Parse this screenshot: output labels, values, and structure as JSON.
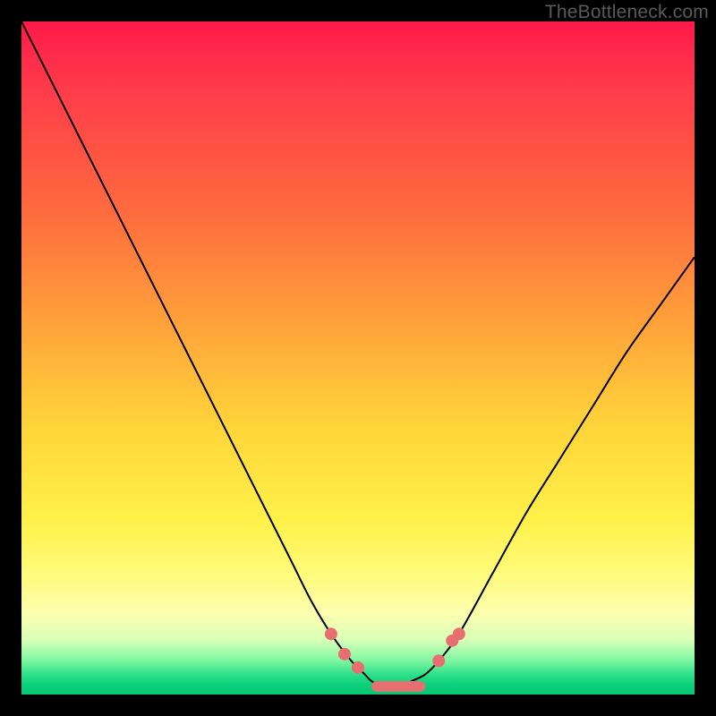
{
  "watermark": "TheBottleneck.com",
  "colors": {
    "frame": "#000000",
    "curve": "#000000",
    "marker": "#e76f6f",
    "gradient_top": "#ff1a48",
    "gradient_bottom": "#08c774"
  },
  "chart_data": {
    "type": "line",
    "title": "",
    "xlabel": "",
    "ylabel": "",
    "xlim": [
      0,
      100
    ],
    "ylim": [
      0,
      100
    ],
    "series": [
      {
        "name": "bottleneck-curve",
        "x": [
          0,
          5,
          10,
          15,
          20,
          25,
          30,
          35,
          40,
          43,
          46,
          49,
          51,
          52,
          54,
          56,
          58,
          60,
          62,
          65,
          70,
          75,
          80,
          85,
          90,
          95,
          100
        ],
        "values": [
          100,
          90,
          80,
          70,
          60,
          50,
          40,
          30,
          20,
          14,
          9,
          5,
          3,
          2,
          1,
          1,
          2,
          3,
          5,
          9,
          18,
          27,
          35,
          43,
          51,
          58,
          65
        ]
      }
    ],
    "markers": {
      "name": "highlight-dots",
      "points": [
        {
          "x": 46,
          "y": 9
        },
        {
          "x": 48,
          "y": 6
        },
        {
          "x": 50,
          "y": 4
        },
        {
          "x": 62,
          "y": 5
        },
        {
          "x": 64,
          "y": 8
        },
        {
          "x": 65,
          "y": 9
        }
      ],
      "bar": {
        "x0": 52,
        "x1": 60,
        "y": 1.2
      }
    }
  }
}
